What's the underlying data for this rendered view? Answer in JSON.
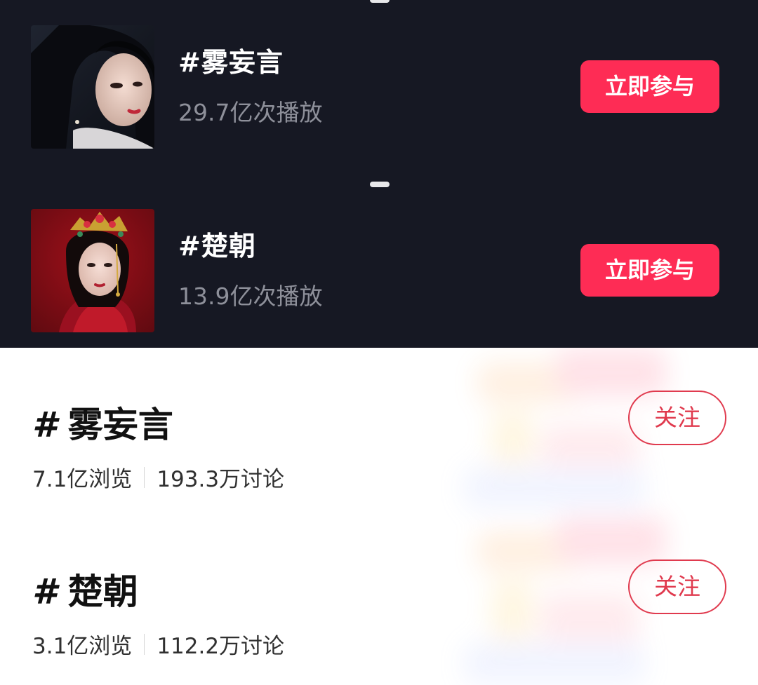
{
  "participate_list": [
    {
      "title": "#雾妄言",
      "plays": "29.7亿次播放",
      "button_label": "立即参与",
      "thumbnail": "portrait-woman-black-hair-dark-background"
    },
    {
      "title": "#楚朝",
      "plays": "13.9亿次播放",
      "button_label": "立即参与",
      "thumbnail": "portrait-woman-red-bridal-headdress"
    }
  ],
  "follow_list": [
    {
      "hash": "#",
      "name": "雾妄言",
      "views": "7.1亿浏览",
      "discussions": "193.3万讨论",
      "button_label": "关注"
    },
    {
      "hash": "#",
      "name": "楚朝",
      "views": "3.1亿浏览",
      "discussions": "112.2万讨论",
      "button_label": "关注"
    }
  ],
  "colors": {
    "dark_bg": "#161823",
    "accent_red": "#fe2c55",
    "follow_red": "#e03a4e"
  }
}
